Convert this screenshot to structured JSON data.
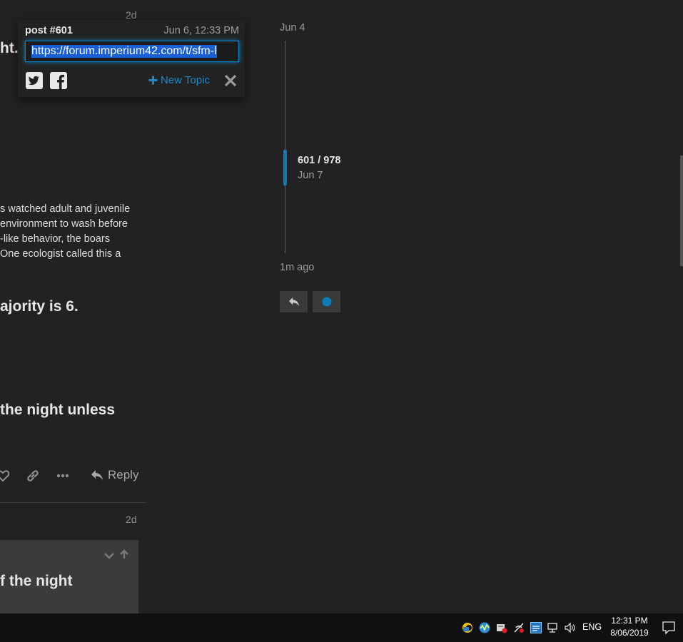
{
  "post": {
    "age_top": "2d",
    "heading_partial": "ht.",
    "paragraph_lines": [
      "s watched adult and juvenile",
      "environment to wash before",
      "-like behavior, the boars",
      "One ecologist called this a"
    ],
    "heading_majority": "ajority is 6.",
    "heading_night": "the night unless",
    "reply_label": "Reply"
  },
  "next_post": {
    "age": "2d",
    "quote_heading": "f the night"
  },
  "share_popup": {
    "title": "post #601",
    "date": "Jun 6, 12:33 PM",
    "url": "https://forum.imperium42.com/t/sfm-l",
    "new_topic_label": "New Topic",
    "icons": [
      "twitter-icon",
      "facebook-icon",
      "plus-icon",
      "close-icon"
    ]
  },
  "timeline": {
    "start_date": "Jun 4",
    "position_label": "601 / 978",
    "position_date": "Jun 7",
    "end_label": "1m ago",
    "accent": "#0a7cb8"
  },
  "taskbar": {
    "language": "ENG",
    "time": "12:31 PM",
    "date": "8/06/2019"
  }
}
